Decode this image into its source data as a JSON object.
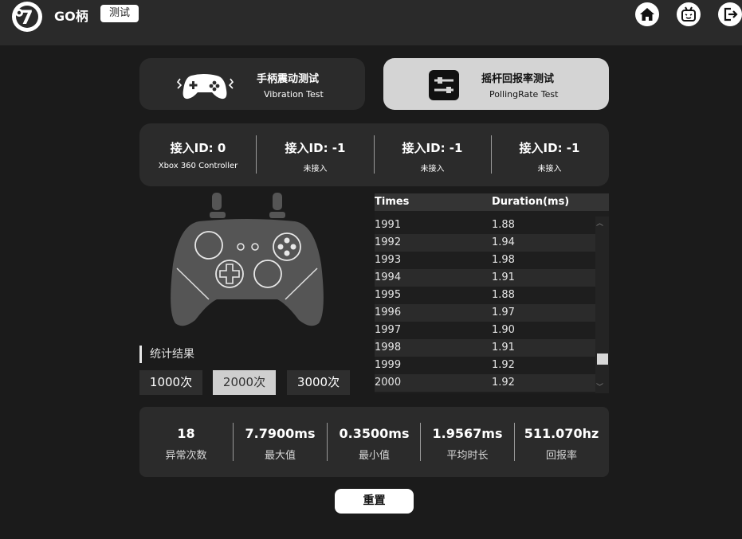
{
  "app": {
    "brand": "GO柄",
    "badge": "测试"
  },
  "header_icons": [
    "home-icon",
    "bilibili-tv-icon",
    "logout-icon"
  ],
  "modes": [
    {
      "title": "手柄震动测试",
      "subtitle": "Vibration Test",
      "icon": "gamepad-vibration-icon",
      "selected": false
    },
    {
      "title": "摇杆回报率测试",
      "subtitle": "PollingRate Test",
      "icon": "sliders-icon",
      "selected": true
    }
  ],
  "controllers": [
    {
      "title": "接入ID: 0",
      "status": "Xbox 360 Controller"
    },
    {
      "title": "接入ID: -1",
      "status": "未接入"
    },
    {
      "title": "接入ID: -1",
      "status": "未接入"
    },
    {
      "title": "接入ID: -1",
      "status": "未接入"
    }
  ],
  "stats_label": "统计结果",
  "count_buttons": [
    {
      "label": "1000次",
      "selected": false
    },
    {
      "label": "2000次",
      "selected": true
    },
    {
      "label": "3000次",
      "selected": false
    }
  ],
  "table": {
    "headers": [
      "Times",
      "Duration(ms)"
    ],
    "rows": [
      [
        "1991",
        "1.88"
      ],
      [
        "1992",
        "1.94"
      ],
      [
        "1993",
        "1.98"
      ],
      [
        "1994",
        "1.91"
      ],
      [
        "1995",
        "1.88"
      ],
      [
        "1996",
        "1.97"
      ],
      [
        "1997",
        "1.90"
      ],
      [
        "1998",
        "1.91"
      ],
      [
        "1999",
        "1.92"
      ],
      [
        "2000",
        "1.92"
      ]
    ]
  },
  "summary": [
    {
      "value": "18",
      "label": "异常次数"
    },
    {
      "value": "7.7900ms",
      "label": "最大值"
    },
    {
      "value": "0.3500ms",
      "label": "最小值"
    },
    {
      "value": "1.9567ms",
      "label": "平均时长"
    },
    {
      "value": "511.070hz",
      "label": "回报率"
    }
  ],
  "reset_label": "重置",
  "colors": {
    "background": "#1b1b1b",
    "panel": "#2b2b2b",
    "selected": "#d4d4d4",
    "accent": "#ffffff"
  }
}
